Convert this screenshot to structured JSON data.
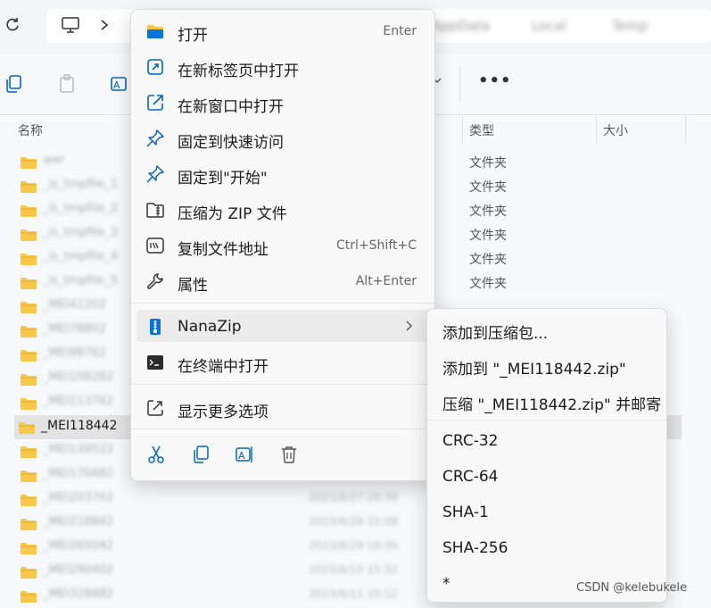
{
  "explorer": {
    "breadcrumbs": [
      "AppData",
      "Local",
      "Temp"
    ],
    "columns": {
      "name": "名称",
      "type": "类型",
      "size": "大小"
    },
    "rows": [
      {
        "name": "wer",
        "date": "",
        "type": "文件夹"
      },
      {
        "name": "_is_tmpfile_1",
        "date": "",
        "type": "文件夹"
      },
      {
        "name": "_is_tmpfile_2",
        "date": "",
        "type": "文件夹"
      },
      {
        "name": "_is_tmpfile_3",
        "date": "",
        "type": "文件夹"
      },
      {
        "name": "_is_tmpfile_4",
        "date": "",
        "type": "文件夹"
      },
      {
        "name": "_is_tmpfile_5",
        "date": "",
        "type": "文件夹"
      },
      {
        "name": "_MEI41202",
        "date": "",
        "type": ""
      },
      {
        "name": "_MEI78802",
        "date": "",
        "type": ""
      },
      {
        "name": "_MEI98762",
        "date": "",
        "type": ""
      },
      {
        "name": "_MEI108282",
        "date": "",
        "type": ""
      },
      {
        "name": "_MEI113762",
        "date": "",
        "type": ""
      },
      {
        "name": "_MEI139522",
        "date": "",
        "type": ""
      },
      {
        "name": "_MEI176682",
        "date": "",
        "type": ""
      },
      {
        "name": "_MEI203762",
        "date": "2023/6/27 20:30",
        "type": ""
      },
      {
        "name": "_MEI218842",
        "date": "2023/6/28 22:08",
        "type": ""
      },
      {
        "name": "_MEI265042",
        "date": "2023/6/29 16:30",
        "type": ""
      },
      {
        "name": "_MEI290402",
        "date": "2023/6/10 15:32",
        "type": ""
      },
      {
        "name": "_MEI328882",
        "date": "2023/6/11 10:12",
        "type": ""
      }
    ],
    "selected_name": "_MEI118442"
  },
  "context_menu": {
    "items": [
      {
        "label": "打开",
        "shortcut": "Enter",
        "icon": "folder-open-icon"
      },
      {
        "label": "在新标签页中打开",
        "shortcut": "",
        "icon": "new-tab-icon"
      },
      {
        "label": "在新窗口中打开",
        "shortcut": "",
        "icon": "new-window-icon"
      },
      {
        "label": "固定到快速访问",
        "shortcut": "",
        "icon": "pin-icon"
      },
      {
        "label": "固定到\"开始\"",
        "shortcut": "",
        "icon": "pin-start-icon"
      },
      {
        "label": "压缩为 ZIP 文件",
        "shortcut": "",
        "icon": "zip-icon"
      },
      {
        "label": "复制文件地址",
        "shortcut": "Ctrl+Shift+C",
        "icon": "copy-path-icon"
      },
      {
        "label": "属性",
        "shortcut": "Alt+Enter",
        "icon": "wrench-icon"
      }
    ],
    "nanazip": {
      "label": "NanaZip",
      "icon": "nanazip-icon"
    },
    "terminal": {
      "label": "在终端中打开",
      "icon": "terminal-icon"
    },
    "more": {
      "label": "显示更多选项",
      "icon": "more-options-icon"
    },
    "quick_actions": [
      "cut-icon",
      "copy-icon",
      "rename-icon",
      "delete-icon"
    ]
  },
  "submenu": {
    "items": [
      "添加到压缩包...",
      "添加到 \"_MEI118442.zip\"",
      "压缩 \"_MEI118442.zip\" 并邮寄",
      "CRC-32",
      "CRC-64",
      "SHA-1",
      "SHA-256",
      "*"
    ]
  },
  "watermark": "CSDN @kelebukele",
  "colors": {
    "folder": "#f8c84a",
    "accent": "#0067c0"
  }
}
